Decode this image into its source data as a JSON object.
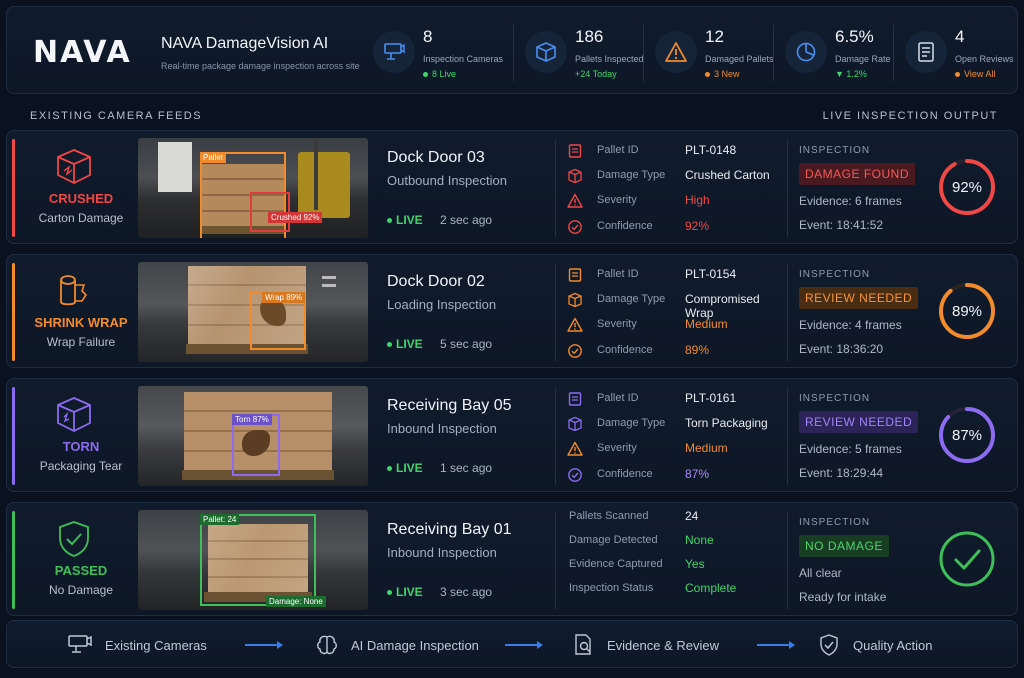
{
  "header": {
    "logo": "NAVA",
    "title": "NAVA DamageVision AI",
    "subtitle": "Real-time package damage inspection across site",
    "stats": [
      {
        "icon": "camera-icon",
        "value": "8",
        "label": "Inspection Cameras",
        "sub": "8 Live",
        "color": "#3fd46e"
      },
      {
        "icon": "box-icon",
        "value": "186",
        "label": "Pallets Inspected",
        "sub": "+24 Today",
        "color": "#3fd46e"
      },
      {
        "icon": "warning-icon",
        "value": "12",
        "label": "Damaged Pallets",
        "sub": "3 New",
        "color": "#f28b2b"
      },
      {
        "icon": "pie-chart-icon",
        "value": "6.5%",
        "label": "Damage Rate",
        "sub": "1.2%",
        "color": "#3fd46e"
      },
      {
        "icon": "document-icon",
        "value": "4",
        "label": "Open Reviews",
        "sub": "View All",
        "color": "#f28b2b"
      }
    ]
  },
  "sections": {
    "left": "EXISTING CAMERA FEEDS",
    "right": "LIVE INSPECTION OUTPUT"
  },
  "rows": [
    {
      "damage_title": "CRUSHED",
      "damage_sub": "Carton Damage",
      "color": "#f04747",
      "tags": [
        "Pallet",
        "Crushed 92%"
      ],
      "location": "Dock Door 03",
      "inspection": "Outbound Inspection",
      "live": "LIVE",
      "ago": "2 sec ago",
      "fields": [
        {
          "label": "Pallet ID",
          "value": "PLT-0148"
        },
        {
          "label": "Damage Type",
          "value": "Crushed Carton"
        },
        {
          "label": "Severity",
          "value": "High"
        },
        {
          "label": "Confidence",
          "value": "92%"
        }
      ],
      "inspection_header": "INSPECTION",
      "badge": "DAMAGE FOUND",
      "evidence": "Evidence: 6 frames",
      "event": "Event:  18:41:52",
      "ring": "92%",
      "ring_value": 0.92
    },
    {
      "damage_title": "SHRINK WRAP",
      "damage_sub": "Wrap Failure",
      "color": "#f28b2b",
      "tags": [
        "Wrap 89%"
      ],
      "location": "Dock Door 02",
      "inspection": "Loading Inspection",
      "live": "LIVE",
      "ago": "5 sec ago",
      "fields": [
        {
          "label": "Pallet ID",
          "value": "PLT-0154"
        },
        {
          "label": "Damage Type",
          "value": "Compromised Wrap"
        },
        {
          "label": "Severity",
          "value": "Medium"
        },
        {
          "label": "Confidence",
          "value": "89%"
        }
      ],
      "inspection_header": "INSPECTION",
      "badge": "REVIEW NEEDED",
      "evidence": "Evidence: 4 frames",
      "event": "Event:  18:36:20",
      "ring": "89%",
      "ring_value": 0.89
    },
    {
      "damage_title": "TORN",
      "damage_sub": "Packaging Tear",
      "color": "#8b6cf0",
      "tags": [
        "Torn 87%"
      ],
      "location": "Receiving Bay 05",
      "inspection": "Inbound Inspection",
      "live": "LIVE",
      "ago": "1 sec ago",
      "fields": [
        {
          "label": "Pallet ID",
          "value": "PLT-0161"
        },
        {
          "label": "Damage Type",
          "value": "Torn Packaging"
        },
        {
          "label": "Severity",
          "value": "Medium"
        },
        {
          "label": "Confidence",
          "value": "87%"
        }
      ],
      "inspection_header": "INSPECTION",
      "badge": "REVIEW NEEDED",
      "evidence": "Evidence: 5 frames",
      "event": "Event:  18:29:44",
      "ring": "87%",
      "ring_value": 0.87
    },
    {
      "damage_title": "PASSED",
      "damage_sub": "No Damage",
      "color": "#3fbf5a",
      "tags": [
        "Pallet: 24",
        "Damage: None"
      ],
      "location": "Receiving Bay 01",
      "inspection": "Inbound Inspection",
      "live": "LIVE",
      "ago": "3 sec ago",
      "fields": [
        {
          "label": "Pallets Scanned",
          "value": "24"
        },
        {
          "label": "Damage Detected",
          "value": "None"
        },
        {
          "label": "Evidence Captured",
          "value": "Yes"
        },
        {
          "label": "Inspection Status",
          "value": "Complete"
        }
      ],
      "inspection_header": "INSPECTION",
      "badge": "NO DAMAGE",
      "evidence": "All clear",
      "event": "Ready for intake"
    }
  ],
  "footer": [
    "Existing Cameras",
    "AI Damage Inspection",
    "Evidence & Review",
    "Quality Action"
  ]
}
